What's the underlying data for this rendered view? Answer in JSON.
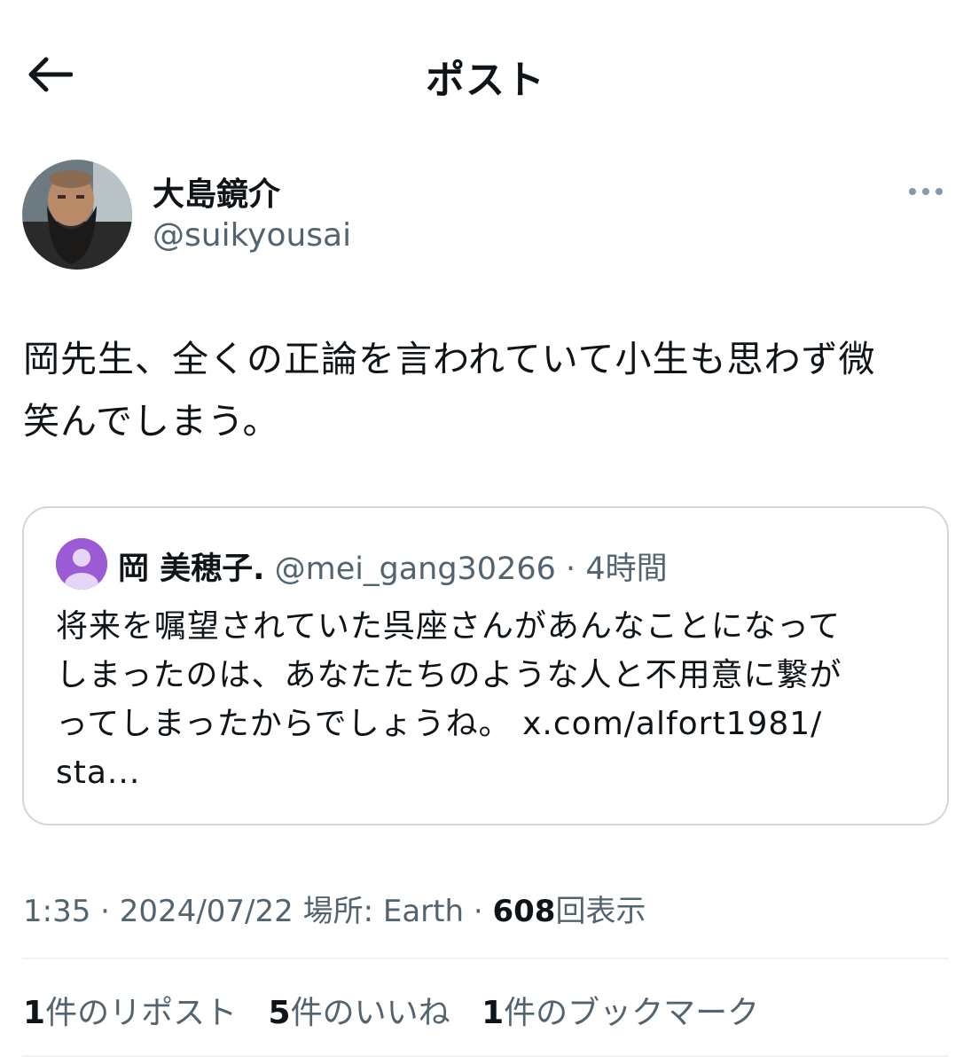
{
  "header": {
    "title": "ポスト",
    "back_icon": "arrow-left-icon"
  },
  "author": {
    "name": "大島鏡介",
    "handle": "@suikyousai",
    "more_icon": "more-horizontal-icon"
  },
  "tweet": {
    "line1": "岡先生、全くの正論を言われていて小生も思わず微",
    "line2": "笑んでしまう。"
  },
  "quote": {
    "name": "岡 美穂子.",
    "handle": "@mei_gang30266",
    "separator": "·",
    "time": "4時間",
    "line1": "将来を嘱望されていた呉座さんがあんなことになって",
    "line2": "しまったのは、あなたたちのような人と不用意に繋が",
    "line3": "ってしまったからでしょうね。 x.com/alfort1981/",
    "line4": "sta..."
  },
  "meta": {
    "time": "1:35",
    "date": "2024/07/22",
    "location_label": "場所: Earth",
    "separator": "·",
    "views_count": "608",
    "views_label": "回表示"
  },
  "stats": {
    "reposts_count": "1",
    "reposts_label": "件のリポスト",
    "likes_count": "5",
    "likes_label": "件のいいね",
    "bookmarks_count": "1",
    "bookmarks_label": "件のブックマーク"
  },
  "colors": {
    "text": "#0f1419",
    "secondary": "#536471",
    "border": "#cfd9de",
    "divider": "#eff3f4",
    "default_avatar": "#9b5bd4"
  }
}
